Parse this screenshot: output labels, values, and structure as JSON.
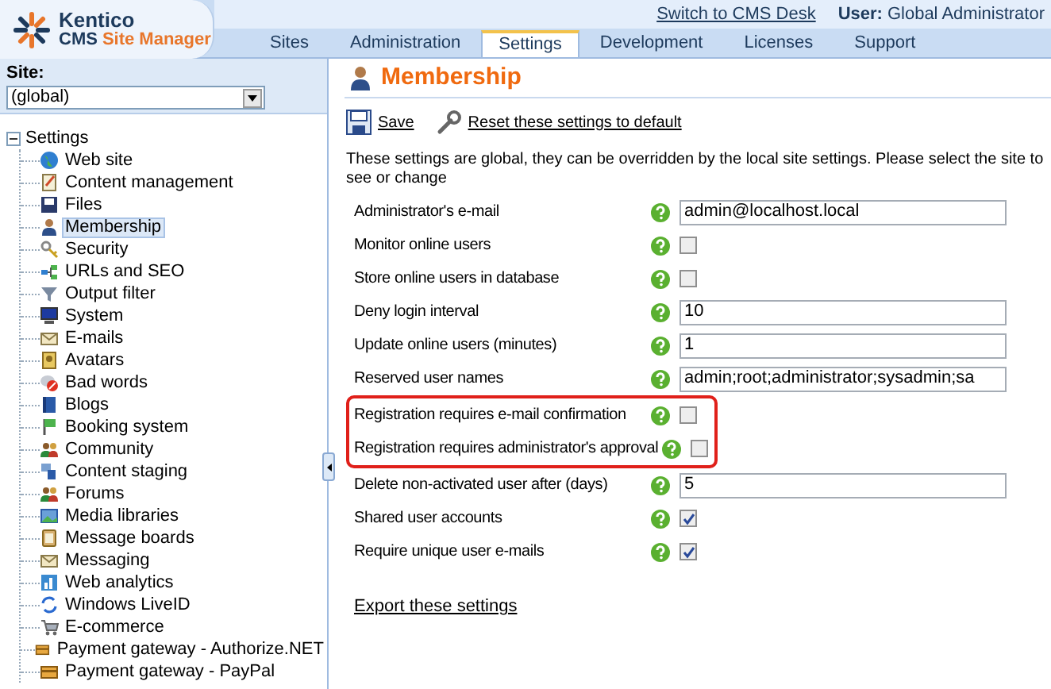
{
  "header": {
    "logo_top": "Kentico",
    "logo_bottom_1": "CMS",
    "logo_bottom_2": "Site Manager",
    "switch_link": "Switch to CMS Desk",
    "user_label": "User:",
    "user_name": "Global Administrator"
  },
  "tabs": [
    {
      "label": "Sites",
      "selected": false
    },
    {
      "label": "Administration",
      "selected": false
    },
    {
      "label": "Settings",
      "selected": true
    },
    {
      "label": "Development",
      "selected": false
    },
    {
      "label": "Licenses",
      "selected": false
    },
    {
      "label": "Support",
      "selected": false
    }
  ],
  "site_selector": {
    "label": "Site:",
    "value": "(global)"
  },
  "tree": {
    "label": "Settings",
    "expanded": true,
    "children": [
      {
        "label": "Web site",
        "selected": false
      },
      {
        "label": "Content management",
        "selected": false
      },
      {
        "label": "Files",
        "selected": false
      },
      {
        "label": "Membership",
        "selected": true
      },
      {
        "label": "Security",
        "selected": false
      },
      {
        "label": "URLs and SEO",
        "selected": false
      },
      {
        "label": "Output filter",
        "selected": false
      },
      {
        "label": "System",
        "selected": false
      },
      {
        "label": "E-mails",
        "selected": false
      },
      {
        "label": "Avatars",
        "selected": false
      },
      {
        "label": "Bad words",
        "selected": false
      },
      {
        "label": "Blogs",
        "selected": false
      },
      {
        "label": "Booking system",
        "selected": false
      },
      {
        "label": "Community",
        "selected": false
      },
      {
        "label": "Content staging",
        "selected": false
      },
      {
        "label": "Forums",
        "selected": false
      },
      {
        "label": "Media libraries",
        "selected": false
      },
      {
        "label": "Message boards",
        "selected": false
      },
      {
        "label": "Messaging",
        "selected": false
      },
      {
        "label": "Web analytics",
        "selected": false
      },
      {
        "label": "Windows LiveID",
        "selected": false
      },
      {
        "label": "E-commerce",
        "selected": false
      },
      {
        "label": "Payment gateway - Authorize.NET",
        "selected": false
      },
      {
        "label": "Payment gateway - PayPal",
        "selected": false
      }
    ]
  },
  "page_title": "Membership",
  "toolbar": [
    {
      "label": "Save",
      "kind": "save"
    },
    {
      "label": "Reset these settings to default",
      "kind": "reset"
    }
  ],
  "description": "These settings are global, they can be overridden by the local site settings. Please select the site to see or change",
  "settings": [
    {
      "label": "Administrator's e-mail",
      "kind": "text",
      "value": "admin@localhost.local",
      "highlighted": false
    },
    {
      "label": "Monitor online users",
      "kind": "checkbox",
      "checked": false,
      "highlighted": false
    },
    {
      "label": "Store online users in database",
      "kind": "checkbox",
      "checked": false,
      "highlighted": false
    },
    {
      "label": "Deny login interval",
      "kind": "text",
      "value": "10",
      "highlighted": false
    },
    {
      "label": "Update online users (minutes)",
      "kind": "text",
      "value": "1",
      "highlighted": false
    },
    {
      "label": "Reserved user names",
      "kind": "text",
      "value": "admin;root;administrator;sysadmin;sa",
      "highlighted": false
    },
    {
      "label": "Registration requires e-mail confirmation",
      "kind": "checkbox",
      "checked": false,
      "highlighted": true
    },
    {
      "label": "Registration requires administrator's approval",
      "kind": "checkbox",
      "checked": false,
      "highlighted": true
    },
    {
      "label": "Delete non-activated user after (days)",
      "kind": "text",
      "value": "5",
      "highlighted": false
    },
    {
      "label": "Shared user accounts",
      "kind": "checkbox",
      "checked": true,
      "highlighted": false
    },
    {
      "label": "Require unique user e-mails",
      "kind": "checkbox",
      "checked": true,
      "highlighted": false
    }
  ],
  "export_link": "Export these settings"
}
